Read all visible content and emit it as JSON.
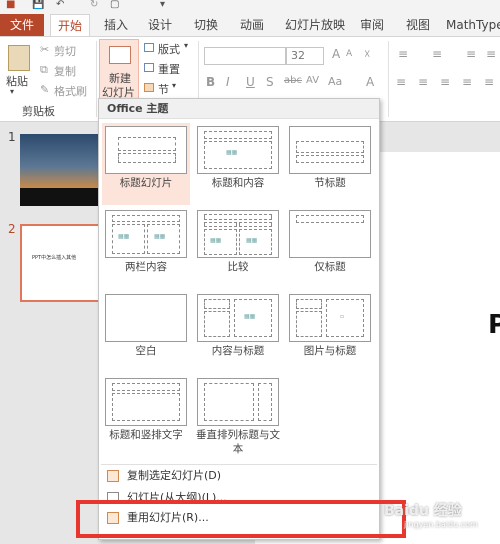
{
  "tabs": [
    "文件",
    "开始",
    "插入",
    "设计",
    "切换",
    "动画",
    "幻灯片放映",
    "审阅",
    "视图",
    "MathType"
  ],
  "clipboard": {
    "paste": "粘贴",
    "cut": "剪切",
    "copy": "复制",
    "format_painter": "格式刷",
    "group": "剪贴板"
  },
  "slides_group": {
    "new_slide_line1": "新建",
    "new_slide_line2": "幻灯片",
    "layout": "版式",
    "reset": "重置",
    "section": "节"
  },
  "font": {
    "size": "32",
    "bold": "B",
    "italic": "I",
    "underline": "U",
    "shadow": "S",
    "strike": "abc",
    "spacing": "AV",
    "case": "Aa",
    "color": "A"
  },
  "thumbnails": {
    "num1": "1",
    "num2": "2",
    "slide2_text": "PPT中怎么插入其他"
  },
  "slide_letter": "P",
  "dropdown": {
    "header": "Office 主题",
    "layouts": [
      {
        "caption": "标题幻灯片"
      },
      {
        "caption": "标题和内容"
      },
      {
        "caption": "节标题"
      },
      {
        "caption": "两栏内容"
      },
      {
        "caption": "比较"
      },
      {
        "caption": "仅标题"
      },
      {
        "caption": "空白"
      },
      {
        "caption": "内容与标题"
      },
      {
        "caption": "图片与标题"
      },
      {
        "caption": "标题和竖排文字"
      },
      {
        "caption": "垂直排列标题与文本"
      }
    ],
    "menu": [
      "复制选定幻灯片(D)",
      "幻灯片(从大纲)(L)...",
      "重用幻灯片(R)..."
    ]
  },
  "watermark": {
    "brand": "Baidu 经验",
    "url": "jingyan.baidu.com"
  },
  "colors": {
    "accent": "#b7472a",
    "highlight": "#e8352d",
    "selected": "#fde4db"
  }
}
